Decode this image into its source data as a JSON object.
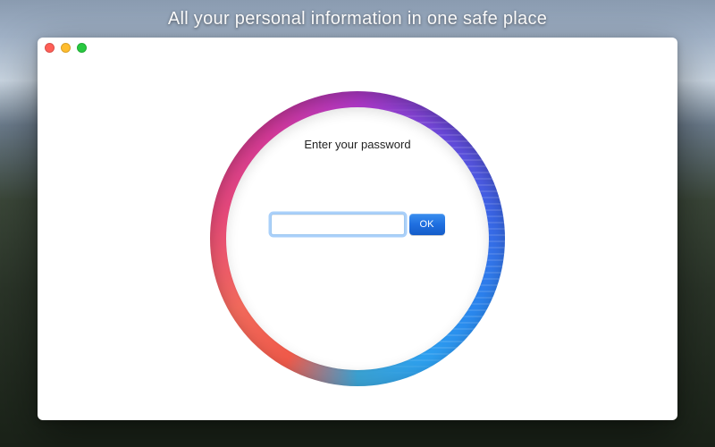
{
  "tagline": "All your personal information in one safe place",
  "window": {
    "traffic_lights": {
      "close": "close",
      "minimize": "minimize",
      "zoom": "zoom"
    }
  },
  "auth": {
    "prompt": "Enter your password",
    "password_value": "",
    "password_placeholder": "",
    "submit_label": "OK"
  },
  "colors": {
    "ring_gradient_stops": [
      "#f05a4a",
      "#e84a7a",
      "#b038c8",
      "#3a66e8",
      "#2da0f0"
    ],
    "ok_button": "#1f6fe0"
  }
}
